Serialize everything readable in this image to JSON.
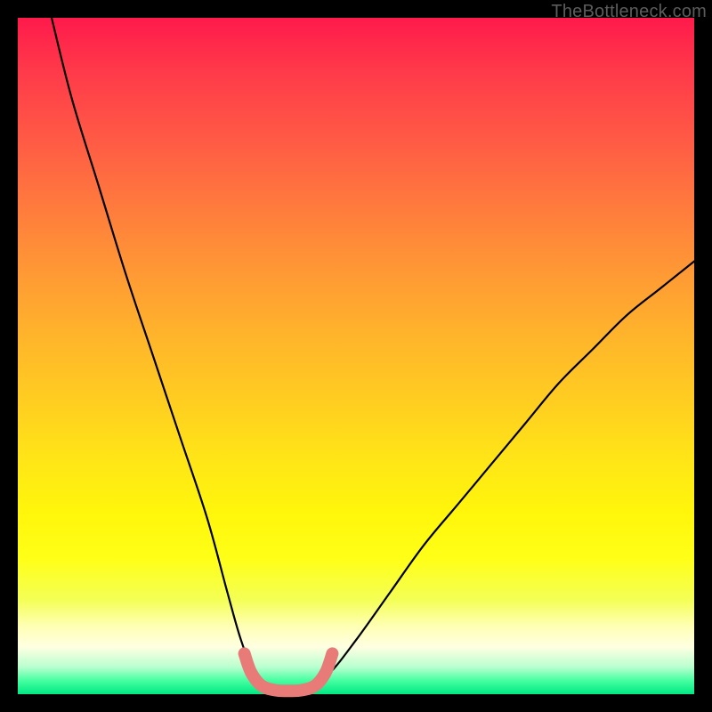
{
  "watermark": "TheBottleneck.com",
  "chart_data": {
    "type": "line",
    "title": "",
    "xlabel": "",
    "ylabel": "",
    "xlim": [
      0,
      100
    ],
    "ylim": [
      0,
      100
    ],
    "series": [
      {
        "name": "bottleneck-curve",
        "x": [
          5,
          8,
          12,
          16,
          20,
          24,
          28,
          31,
          33,
          35,
          37,
          39,
          41,
          43,
          46,
          50,
          55,
          60,
          65,
          70,
          75,
          80,
          85,
          90,
          95,
          100
        ],
        "y": [
          100,
          88,
          75,
          62,
          50,
          38,
          26,
          15,
          8,
          3,
          1,
          0.5,
          0.5,
          1,
          3,
          8,
          15,
          22,
          28,
          34,
          40,
          46,
          51,
          56,
          60,
          64
        ]
      }
    ],
    "highlight": {
      "name": "optimal-basin",
      "x": [
        33.5,
        34.5,
        36,
        38,
        40,
        42,
        44,
        45.5,
        46.5
      ],
      "y": [
        6,
        3.2,
        1.3,
        0.6,
        0.5,
        0.6,
        1.3,
        3.2,
        6
      ]
    },
    "gradient_background": {
      "top_color": "#ff1a4b",
      "mid_color": "#ffe716",
      "bottom_color": "#00e884"
    }
  }
}
